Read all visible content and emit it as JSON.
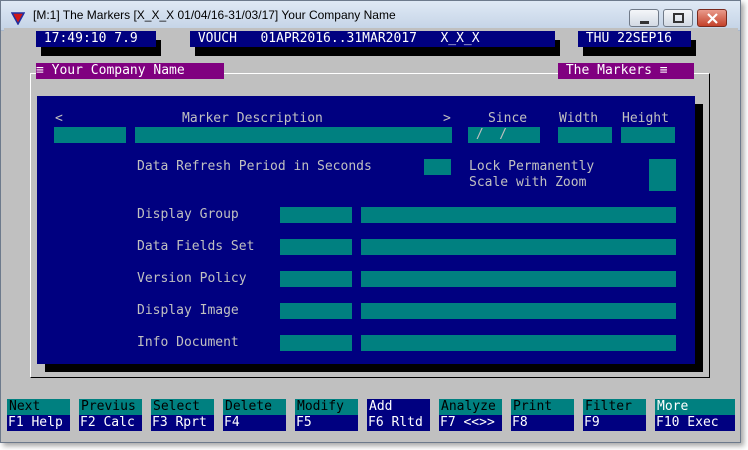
{
  "window": {
    "title": "[M:1]  The Markers  [X_X_X  01/04/16-31/03/17]  Your Company Name"
  },
  "status": {
    "time_version": " 17:49:10 7.9 ",
    "voucher_range": " VOUCH   01APR2016..31MAR2017   X_X_X ",
    "date": " THU 22SEP16 "
  },
  "panel": {
    "left_title": "≡ Your Company Name ",
    "right_title": " The Markers ≡"
  },
  "form": {
    "header_prev": "<",
    "header_description": "Marker Description",
    "header_next": ">",
    "header_since": "Since",
    "header_width": "Width",
    "header_height": "Height",
    "since_value": " /  /",
    "refresh_label": "Data Refresh Period in Seconds",
    "lock_label": "Lock Permanently",
    "scale_label": "Scale with Zoom",
    "display_group_label": "Display Group",
    "data_fields_label": "Data Fields Set",
    "version_policy_label": "Version Policy",
    "display_image_label": "Display Image",
    "info_document_label": "Info Document"
  },
  "function_keys": [
    {
      "top": "Next",
      "bottom": "F1 Help"
    },
    {
      "top": "Previus",
      "bottom": "F2 Calc"
    },
    {
      "top": "Select",
      "bottom": "F3 Rprt"
    },
    {
      "top": "Delete",
      "bottom": "F4"
    },
    {
      "top": "Modify",
      "bottom": "F5"
    },
    {
      "top": "Add",
      "bottom": "F6 Rltd"
    },
    {
      "top": "Analyze",
      "bottom": "F7 <<>>"
    },
    {
      "top": "Print",
      "bottom": "F8"
    },
    {
      "top": "Filter",
      "bottom": "F9"
    },
    {
      "top": "More",
      "bottom": "F10 Exec"
    }
  ],
  "colors": {
    "navy": "#000080",
    "teal": "#008080",
    "purple": "#800080",
    "gray": "#c0c0c0"
  }
}
